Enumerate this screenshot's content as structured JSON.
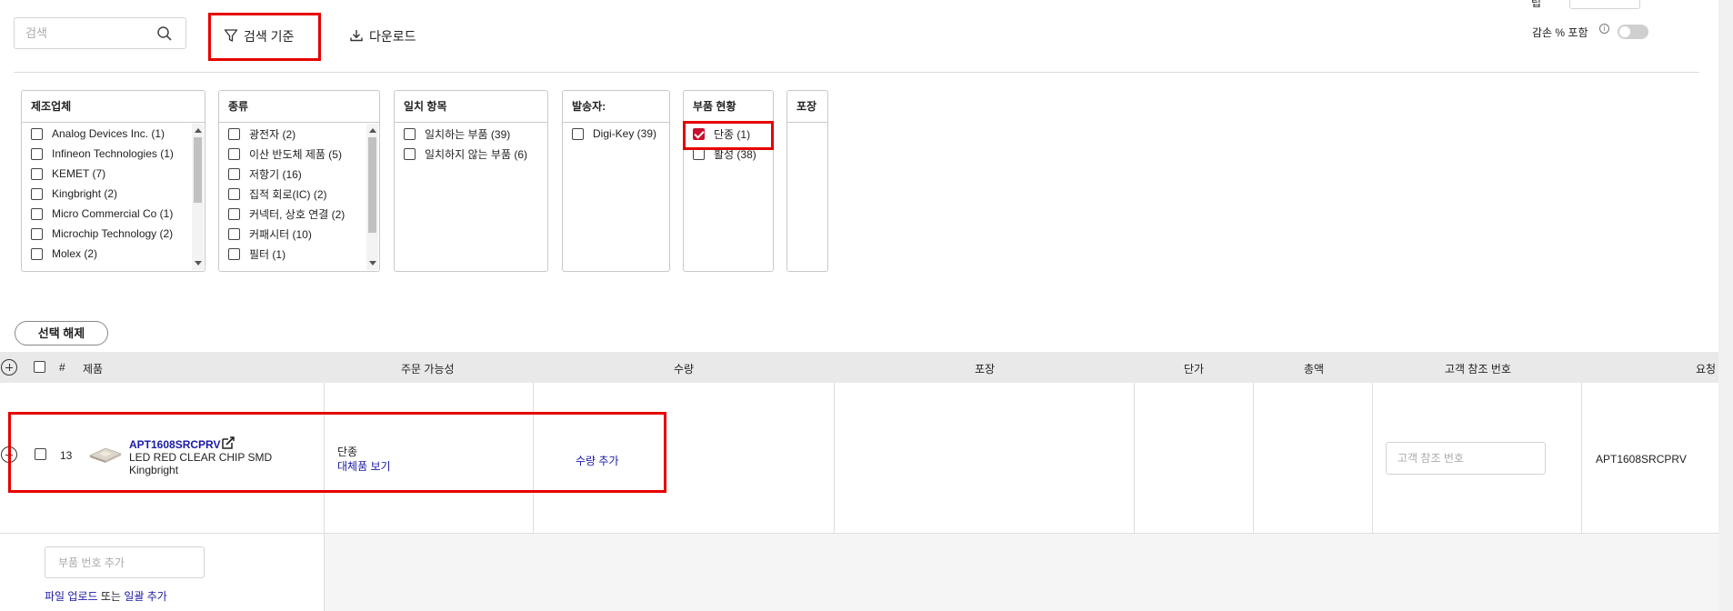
{
  "toolbar": {
    "search_placeholder": "검색",
    "filter_label": "검색 기준",
    "download_label": "다운로드",
    "top_right_label": "립",
    "include_label": "감손 % 포함",
    "info_glyph": "i",
    "highlight_color": "#e60000"
  },
  "filters": {
    "manufacturer": {
      "title": "제조업체",
      "options": [
        "Analog Devices Inc. (1)",
        "Infineon Technologies (1)",
        "KEMET (7)",
        "Kingbright (2)",
        "Micro Commercial Co (1)",
        "Microchip Technology (2)",
        "Molex (2)"
      ]
    },
    "category": {
      "title": "종류",
      "options": [
        "광전자 (2)",
        "이산 반도체 제품 (5)",
        "저항기 (16)",
        "집적 회로(IC) (2)",
        "커넥터, 상호 연결 (2)",
        "커패시터 (10)",
        "필터 (1)"
      ]
    },
    "match": {
      "title": "일치 항목",
      "options": [
        "일치하는 부품 (39)",
        "일치하지 않는 부품 (6)"
      ]
    },
    "shipper": {
      "title": "발송자:",
      "options": [
        "Digi-Key (39)"
      ]
    },
    "part_status": {
      "title": "부품 현황",
      "options": [
        "단종 (1)",
        "활성 (38)"
      ],
      "checked_index": 0
    },
    "packaging": {
      "title": "포장"
    }
  },
  "clear_selection_label": "선택 해제",
  "table": {
    "headers": {
      "index": "#",
      "product": "제품",
      "availability": "주문 가능성",
      "quantity": "수량",
      "packaging": "포장",
      "unit_price": "단가",
      "total": "총액",
      "customer_ref": "고객 참조 번호",
      "request": "요청"
    },
    "row": {
      "index": "13",
      "part_number": "APT1608SRCPRV",
      "description": "LED RED CLEAR CHIP SMD",
      "manufacturer": "Kingbright",
      "availability": "단종",
      "alternatives_link": "대체품 보기",
      "add_quantity_link": "수량 추가",
      "customer_ref_placeholder": "고객 참조 번호",
      "request_value": "APT1608SRCPRV"
    },
    "add_row": {
      "part_placeholder": "부품 번호 추가",
      "upload_link": "파일 업로드",
      "or_text": "또는",
      "bulk_link": "일괄 추가"
    }
  },
  "colors": {
    "link": "#1a1aa6",
    "checked": "#c8102e",
    "header_bg": "#e9e9e9"
  }
}
